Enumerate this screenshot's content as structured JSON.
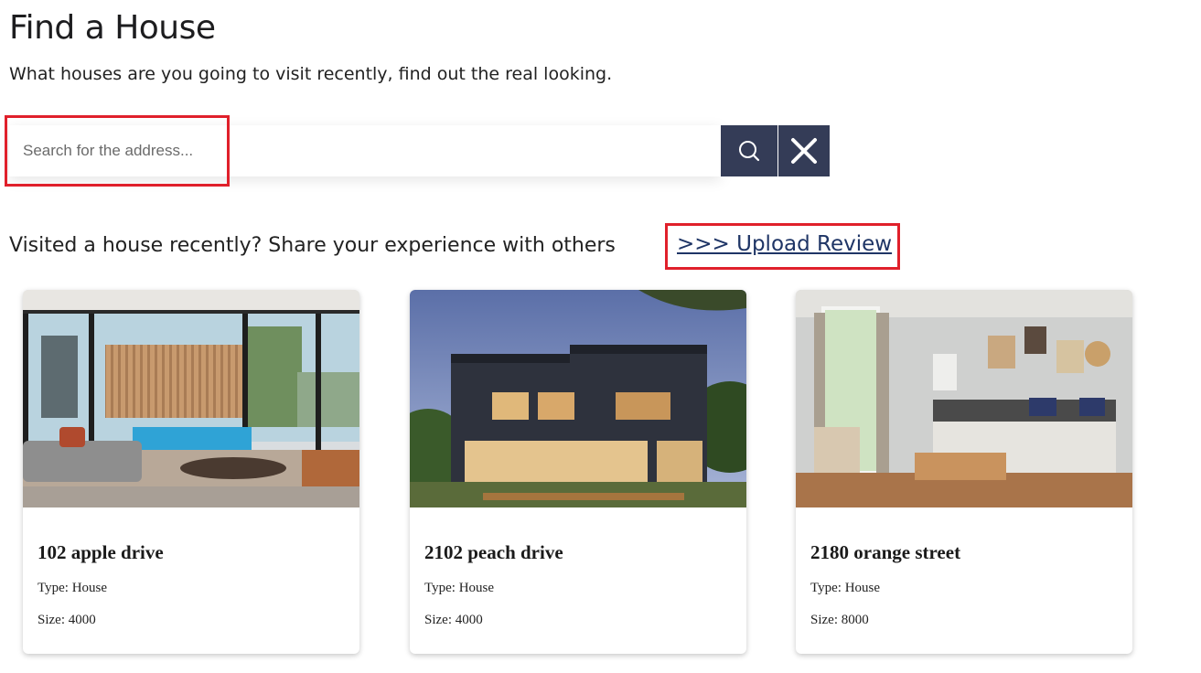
{
  "header": {
    "title": "Find a House",
    "subtitle": "What houses are you going to visit recently, find out the real looking."
  },
  "search": {
    "placeholder": "Search for the address...",
    "value": "",
    "search_icon": "search-icon",
    "clear_icon": "close-icon",
    "button_color": "#343c57"
  },
  "share": {
    "text": "Visited a house recently? Share your experience with others",
    "link_label": ">>> Upload Review"
  },
  "highlight_color": "#e0202b",
  "cards": [
    {
      "title": "102 apple drive",
      "type": "Type: House",
      "size": "Size: 4000"
    },
    {
      "title": "2102 peach drive",
      "type": "Type: House",
      "size": "Size: 4000"
    },
    {
      "title": "2180 orange street",
      "type": "Type: House",
      "size": "Size: 8000"
    }
  ]
}
